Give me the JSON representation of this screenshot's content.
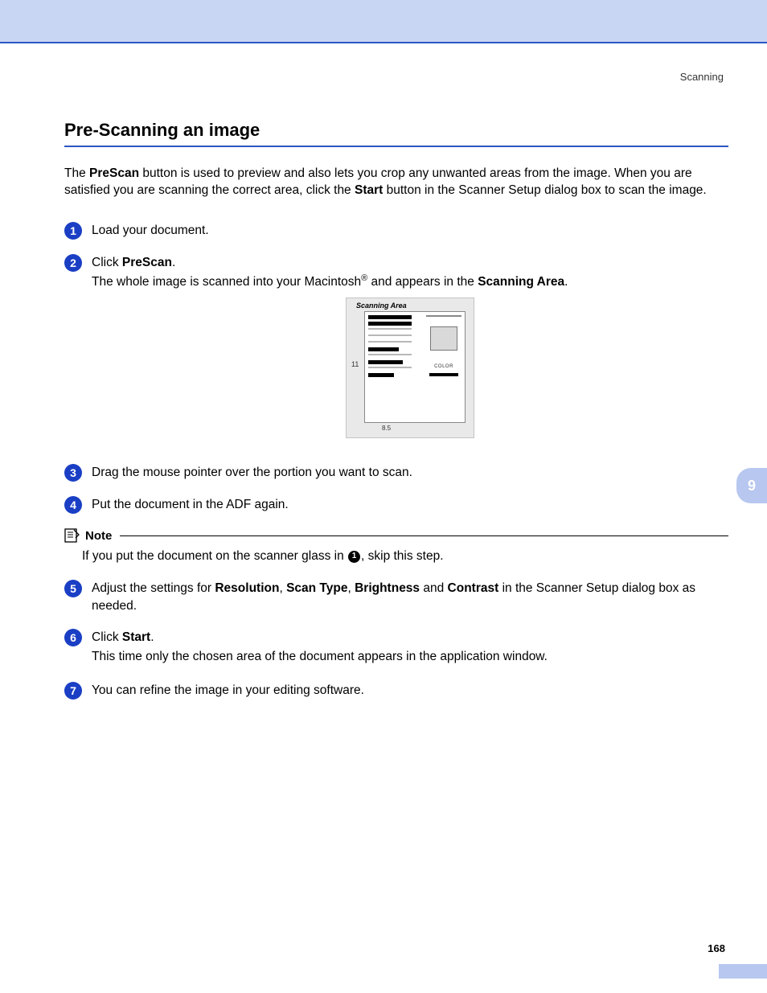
{
  "header": {
    "category": "Scanning"
  },
  "title": "Pre-Scanning an image",
  "intro": {
    "t1": "The ",
    "b1": "PreScan",
    "t2": " button is used to preview and also lets you crop any unwanted areas from the image. When you are satisfied you are scanning the correct area, click the ",
    "b2": "Start",
    "t3": " button in the Scanner Setup dialog box to scan the image."
  },
  "steps": {
    "s1": {
      "num": "1",
      "text": "Load your document."
    },
    "s2": {
      "num": "2",
      "line1_a": "Click ",
      "line1_b": "PreScan",
      "line1_c": ".",
      "line2_a": "The whole image is scanned into your Macintosh",
      "line2_sup": "®",
      "line2_b": " and appears in the ",
      "line2_bold": "Scanning Area",
      "line2_c": "."
    },
    "s3": {
      "num": "3",
      "text": "Drag the mouse pointer over the portion you want to scan."
    },
    "s4": {
      "num": "4",
      "text": "Put the document in the ADF again."
    },
    "s5": {
      "num": "5",
      "t1": "Adjust the settings for ",
      "b1": "Resolution",
      "t2": ", ",
      "b2": "Scan Type",
      "t3": ", ",
      "b3": "Brightness",
      "t4": " and ",
      "b4": "Contrast",
      "t5": " in the Scanner Setup dialog box as needed."
    },
    "s6": {
      "num": "6",
      "line1_a": "Click ",
      "line1_b": "Start",
      "line1_c": ".",
      "line2": "This time only the chosen area of the document appears in the application window."
    },
    "s7": {
      "num": "7",
      "text": "You can refine the image in your editing software."
    }
  },
  "note": {
    "title": "Note",
    "t1": "If you put the document on the scanner glass in ",
    "bullet": "1",
    "t2": ", skip this step."
  },
  "figure": {
    "title": "Scanning Area",
    "marker": "11",
    "ruler": "8.5",
    "color": "COLOR"
  },
  "sidebar": {
    "chapter": "9"
  },
  "footer": {
    "page": "168"
  }
}
